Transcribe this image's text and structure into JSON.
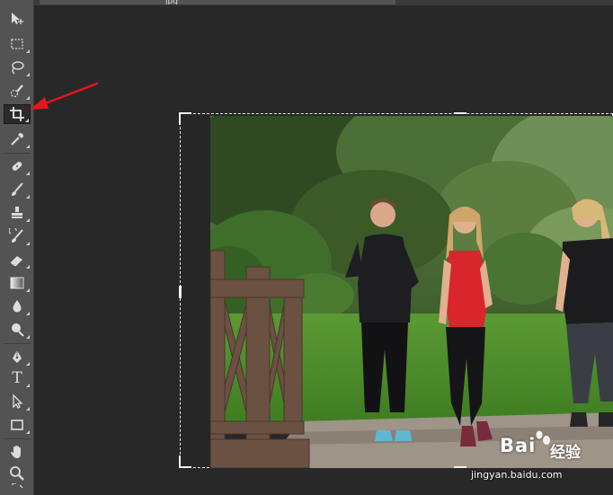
{
  "document_tab": {
    "title": "jpg"
  },
  "toolbar": {
    "tools": [
      {
        "name": "move-tool-icon"
      },
      {
        "name": "rectangular-marquee-tool-icon"
      },
      {
        "name": "lasso-tool-icon"
      },
      {
        "name": "quick-selection-tool-icon"
      },
      {
        "name": "crop-tool-icon",
        "active": true
      },
      {
        "name": "eyedropper-tool-icon"
      },
      {
        "name": "healing-brush-tool-icon"
      },
      {
        "name": "brush-tool-icon"
      },
      {
        "name": "clone-stamp-tool-icon"
      },
      {
        "name": "history-brush-tool-icon"
      },
      {
        "name": "eraser-tool-icon"
      },
      {
        "name": "gradient-tool-icon"
      },
      {
        "name": "blur-tool-icon"
      },
      {
        "name": "dodge-tool-icon"
      },
      {
        "name": "pen-tool-icon"
      },
      {
        "name": "type-tool-icon",
        "glyph": "T"
      },
      {
        "name": "path-selection-tool-icon"
      },
      {
        "name": "rectangle-tool-icon"
      },
      {
        "name": "hand-tool-icon"
      },
      {
        "name": "zoom-tool-icon"
      }
    ]
  },
  "annotation": {
    "arrow_color": "#e8141a"
  },
  "watermark": {
    "brand": "Bai",
    "brand_cn": "经验",
    "url": "jingyan.baidu.com"
  },
  "colors": {
    "toolbar_bg": "#535353",
    "canvas_bg": "#282828",
    "grass": "#4f8a2c",
    "shirt_red": "#d9262c"
  }
}
